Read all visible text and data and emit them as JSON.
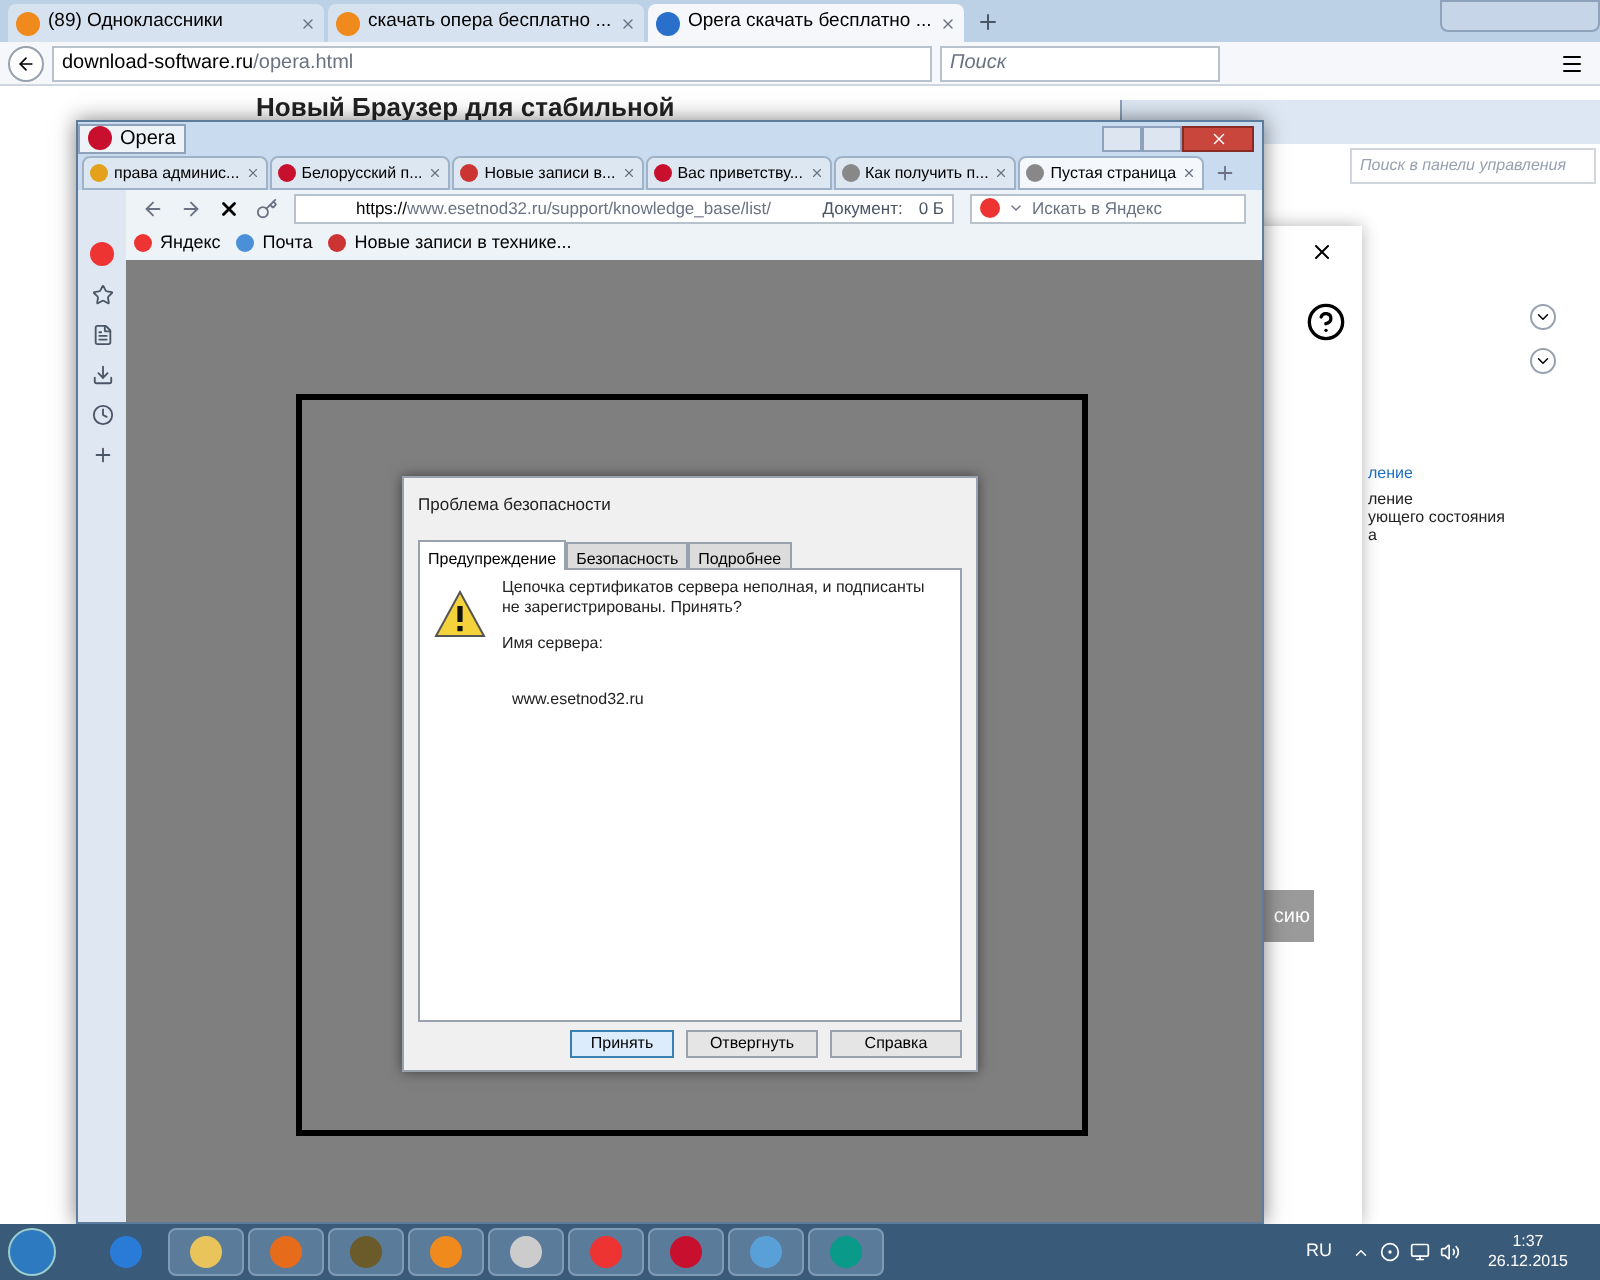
{
  "firefox": {
    "tabs": [
      {
        "label": "(89) Одноклассники",
        "selected": false
      },
      {
        "label": "скачать опера бесплатно ...",
        "selected": false
      },
      {
        "label": "Opera скачать бесплатно ...",
        "selected": true
      }
    ],
    "url_host": "download-software.ru",
    "url_path": "/opera.html",
    "search_placeholder": "Поиск",
    "page_heading": "Новый Браузер для стабильной"
  },
  "control_panel": {
    "search_placeholder": "Поиск в панели управления",
    "fragments": [
      {
        "text": "ление",
        "kind": "link"
      },
      {
        "text": "ление",
        "kind": "text"
      },
      {
        "text": "ующего состояния",
        "kind": "text"
      },
      {
        "text": "а",
        "kind": "text"
      }
    ],
    "button": "сию"
  },
  "opera": {
    "title": "Opera",
    "tabs": [
      {
        "label": "права админис...",
        "selected": false
      },
      {
        "label": "Белорусский п...",
        "selected": false
      },
      {
        "label": "Новые записи в...",
        "selected": false
      },
      {
        "label": "Вас приветству...",
        "selected": false
      },
      {
        "label": "Как получить п...",
        "selected": false
      },
      {
        "label": "Пустая страница",
        "selected": true
      }
    ],
    "url_scheme": "https://",
    "url_rest": "www.esetnod32.ru/support/knowledge_base/list/",
    "document_label": "Документ:",
    "document_size": "0 Б",
    "search_placeholder": "Искать в Яндекс",
    "bookmarks": [
      "Яндекс",
      "Почта",
      "Новые записи в технике..."
    ]
  },
  "dialog": {
    "title": "Проблема безопасности",
    "tabs": [
      {
        "label": "Предупреждение",
        "selected": true
      },
      {
        "label": "Безопасность",
        "selected": false
      },
      {
        "label": "Подробнее",
        "selected": false
      }
    ],
    "message": "Цепочка сертификатов сервера неполная, и подписанты не зарегистрированы. Принять?",
    "server_label": "Имя сервера:",
    "server": "www.esetnod32.ru",
    "buttons": [
      {
        "label": "Принять",
        "default": true
      },
      {
        "label": "Отвергнуть",
        "default": false
      },
      {
        "label": "Справка",
        "default": false
      }
    ]
  },
  "taskbar": {
    "language": "RU",
    "time": "1:37",
    "date": "26.12.2015"
  }
}
